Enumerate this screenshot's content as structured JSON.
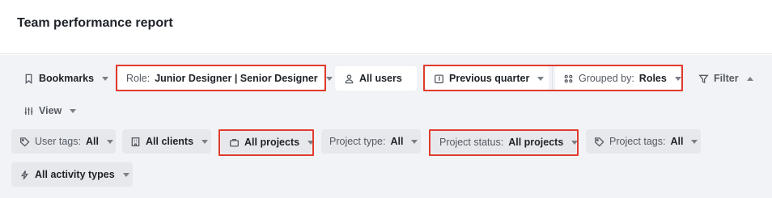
{
  "header": {
    "title": "Team performance report"
  },
  "toolbar": {
    "bookmarks": {
      "label": "Bookmarks"
    },
    "role": {
      "label": "Role:",
      "value": "Junior Designer | Senior Designer"
    },
    "users": {
      "value": "All users"
    },
    "period": {
      "value": "Previous quarter"
    },
    "grouped": {
      "label": "Grouped by:",
      "value": "Roles"
    },
    "filter": {
      "label": "Filter"
    },
    "view": {
      "label": "View"
    }
  },
  "filters": {
    "user_tags": {
      "label": "User tags:",
      "value": "All"
    },
    "clients": {
      "value": "All clients"
    },
    "projects": {
      "value": "All projects"
    },
    "project_type": {
      "label": "Project type:",
      "value": "All"
    },
    "project_status": {
      "label": "Project status:",
      "value": "All projects"
    },
    "project_tags": {
      "label": "Project tags:",
      "value": "All"
    },
    "activity_types": {
      "value": "All activity types"
    }
  },
  "highlight_color": "#e03a2c"
}
